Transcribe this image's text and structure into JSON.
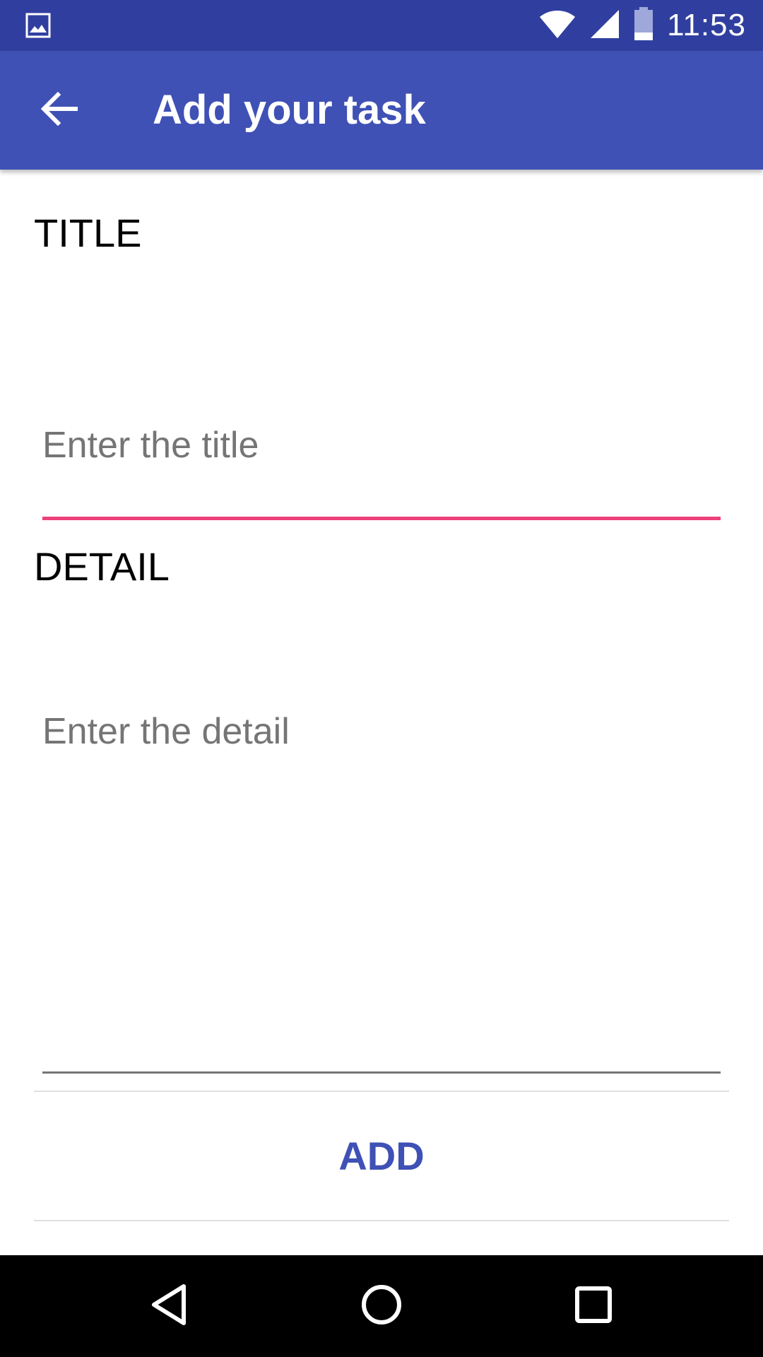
{
  "status_bar": {
    "time": "11:53",
    "icons": [
      "gallery-icon",
      "wifi-icon",
      "signal-icon",
      "battery-icon"
    ],
    "background_color": "#303f9f"
  },
  "app_bar": {
    "title": "Add your task",
    "back_icon": "arrow-back-icon",
    "background_color": "#3f51b5"
  },
  "form": {
    "title_label": "TITLE",
    "title_placeholder": "Enter the title",
    "title_value": "",
    "detail_label": "DETAIL",
    "detail_placeholder": "Enter the detail",
    "detail_value": "",
    "focused_underline_color": "#ec407a"
  },
  "actions": {
    "add_label": "ADD",
    "add_color": "#3f51b5"
  },
  "nav_bar": {
    "icons": [
      "nav-back-icon",
      "nav-home-icon",
      "nav-recents-icon"
    ]
  }
}
